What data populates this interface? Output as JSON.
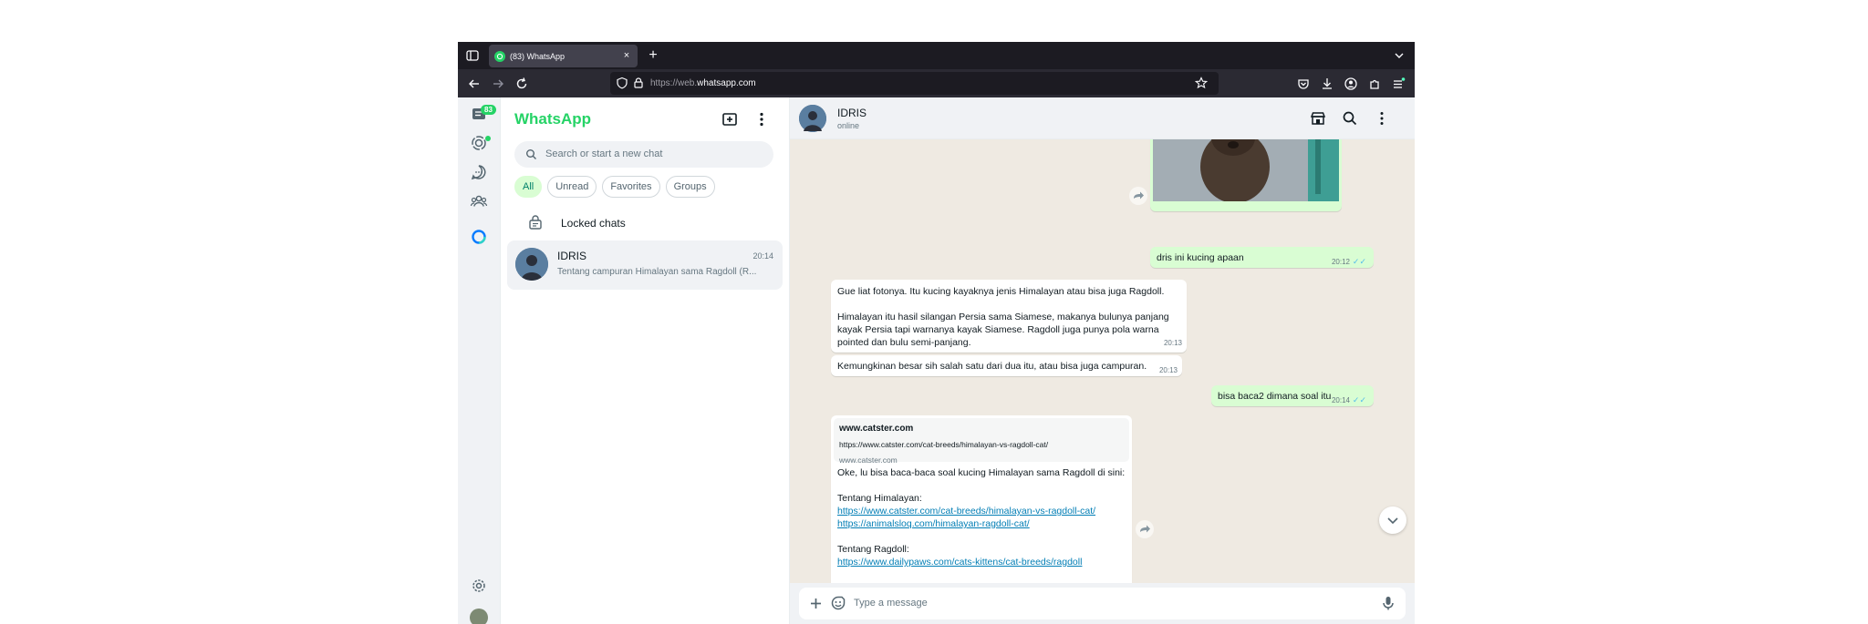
{
  "browser": {
    "tab_title": "(83) WhatsApp",
    "url_prefix": "https://web.",
    "url_domain": "whatsapp.com",
    "close_glyph": "×",
    "new_tab_glyph": "+"
  },
  "rail": {
    "chats_badge": "83"
  },
  "chatlist": {
    "brand": "WhatsApp",
    "search_placeholder": "Search or start a new chat",
    "filters": [
      "All",
      "Unread",
      "Favorites",
      "Groups"
    ],
    "locked_label": "Locked chats",
    "chats": [
      {
        "name": "IDRIS",
        "time": "20:14",
        "preview": "Tentang campuran Himalayan sama Ragdoll (R..."
      }
    ]
  },
  "conversation": {
    "contact_name": "IDRIS",
    "contact_status": "online",
    "messages": {
      "m1_text": "dris ini kucing apaan",
      "m1_time": "20:12",
      "m2_line1": "Gue liat fotonya. Itu kucing kayaknya jenis Himalayan atau bisa juga Ragdoll.",
      "m2_line2": "Himalayan itu hasil silangan Persia sama Siamese, makanya bulunya panjang",
      "m2_line3": "kayak Persia tapi warnanya kayak Siamese. Ragdoll juga punya pola warna",
      "m2_line4": "pointed dan bulu semi-panjang.",
      "m2_time": "20:13",
      "m3_text": "Kemungkinan besar sih salah satu dari dua itu, atau bisa juga campuran.",
      "m3_time": "20:13",
      "m4_text": "bisa baca2 dimana soal itu",
      "m4_time": "20:14",
      "m5_preview_title": "www.catster.com",
      "m5_preview_url": "https://www.catster.com/cat-breeds/himalayan-vs-ragdoll-cat/",
      "m5_preview_domain": "www.catster.com",
      "m5_intro": "Oke, lu bisa baca-baca soal kucing Himalayan sama Ragdoll di sini:",
      "m5_h1": "Tentang Himalayan:",
      "m5_link1": "https://www.catster.com/cat-breeds/himalayan-vs-ragdoll-cat/",
      "m5_link2": "https://animalsloq.com/himalayan-ragdoll-cat/",
      "m5_h2": "Tentang Ragdoll:",
      "m5_link3": "https://www.dailypaws.com/cats-kittens/cat-breeds/ragdoll"
    },
    "composer_placeholder": "Type a message"
  },
  "colors": {
    "brand_green": "#25d366",
    "outgoing_bubble": "#d9fdd3",
    "incoming_bubble": "#ffffff",
    "link": "#027eb5",
    "read_ticks": "#53bdeb"
  }
}
